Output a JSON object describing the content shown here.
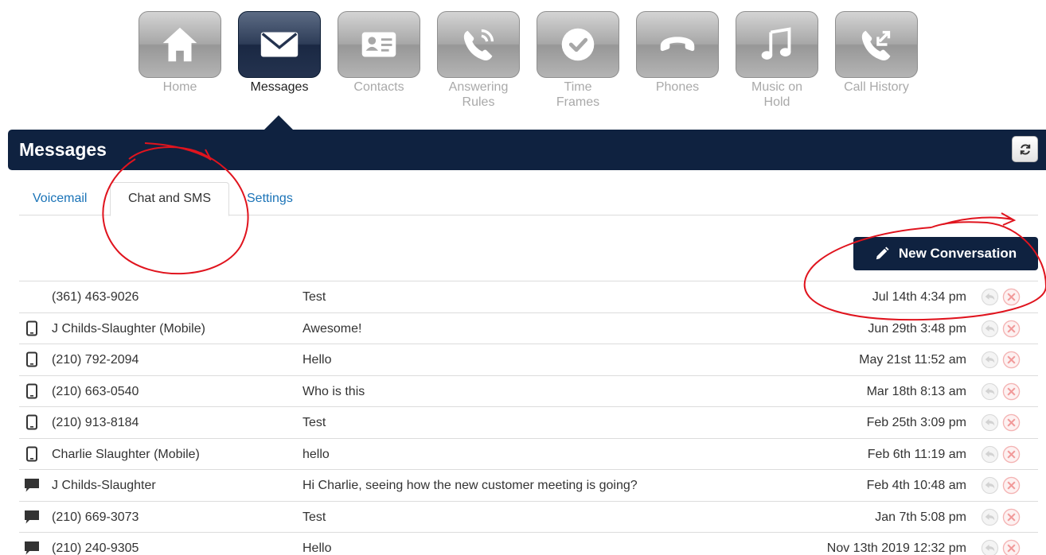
{
  "nav": {
    "items": [
      {
        "label": "Home",
        "icon": "home-icon",
        "active": false
      },
      {
        "label": "Messages",
        "icon": "envelope-icon",
        "active": true
      },
      {
        "label": "Contacts",
        "icon": "contact-card-icon",
        "active": false
      },
      {
        "label": "Answering\nRules",
        "icon": "phone-ringing-icon",
        "active": false
      },
      {
        "label": "Time\nFrames",
        "icon": "clock-icon",
        "active": false
      },
      {
        "label": "Phones",
        "icon": "phone-handset-icon",
        "active": false
      },
      {
        "label": "Music on\nHold",
        "icon": "music-note-icon",
        "active": false
      },
      {
        "label": "Call History",
        "icon": "call-history-icon",
        "active": false
      }
    ]
  },
  "header": {
    "title": "Messages",
    "refresh_icon": "refresh-icon"
  },
  "tabs": {
    "voicemail": "Voicemail",
    "chat": "Chat and SMS",
    "settings": "Settings",
    "active": "chat"
  },
  "actions": {
    "new_conversation": "New Conversation",
    "new_conversation_icon": "pencil-icon"
  },
  "conversations": [
    {
      "type": "none",
      "contact": "(361) 463-9026",
      "preview": "Test",
      "time": "Jul 14th 4:34 pm"
    },
    {
      "type": "mobile",
      "contact": "J Childs-Slaughter (Mobile)",
      "preview": "Awesome!",
      "time": "Jun 29th 3:48 pm"
    },
    {
      "type": "mobile",
      "contact": "(210) 792-2094",
      "preview": "Hello",
      "time": "May 21st 11:52 am"
    },
    {
      "type": "mobile",
      "contact": "(210) 663-0540",
      "preview": "Who is this",
      "time": "Mar 18th 8:13 am"
    },
    {
      "type": "mobile",
      "contact": "(210) 913-8184",
      "preview": "Test",
      "time": "Feb 25th 3:09 pm"
    },
    {
      "type": "mobile",
      "contact": "Charlie Slaughter (Mobile)",
      "preview": "hello",
      "time": "Feb 6th 11:19 am"
    },
    {
      "type": "chat",
      "contact": "J Childs-Slaughter",
      "preview": "Hi Charlie, seeing how the new customer meeting is going?",
      "time": "Feb 4th 10:48 am"
    },
    {
      "type": "chat",
      "contact": "(210) 669-3073",
      "preview": "Test",
      "time": "Jan 7th 5:08 pm"
    },
    {
      "type": "chat",
      "contact": "(210) 240-9305",
      "preview": "Hello",
      "time": "Nov 13th 2019 12:32 pm"
    }
  ],
  "colors": {
    "navy": "#0f2240",
    "link": "#1a73b7",
    "annotation": "#e0141e",
    "row_action_grey": "#d6d6d6",
    "row_action_red": "#f4b3b3"
  }
}
